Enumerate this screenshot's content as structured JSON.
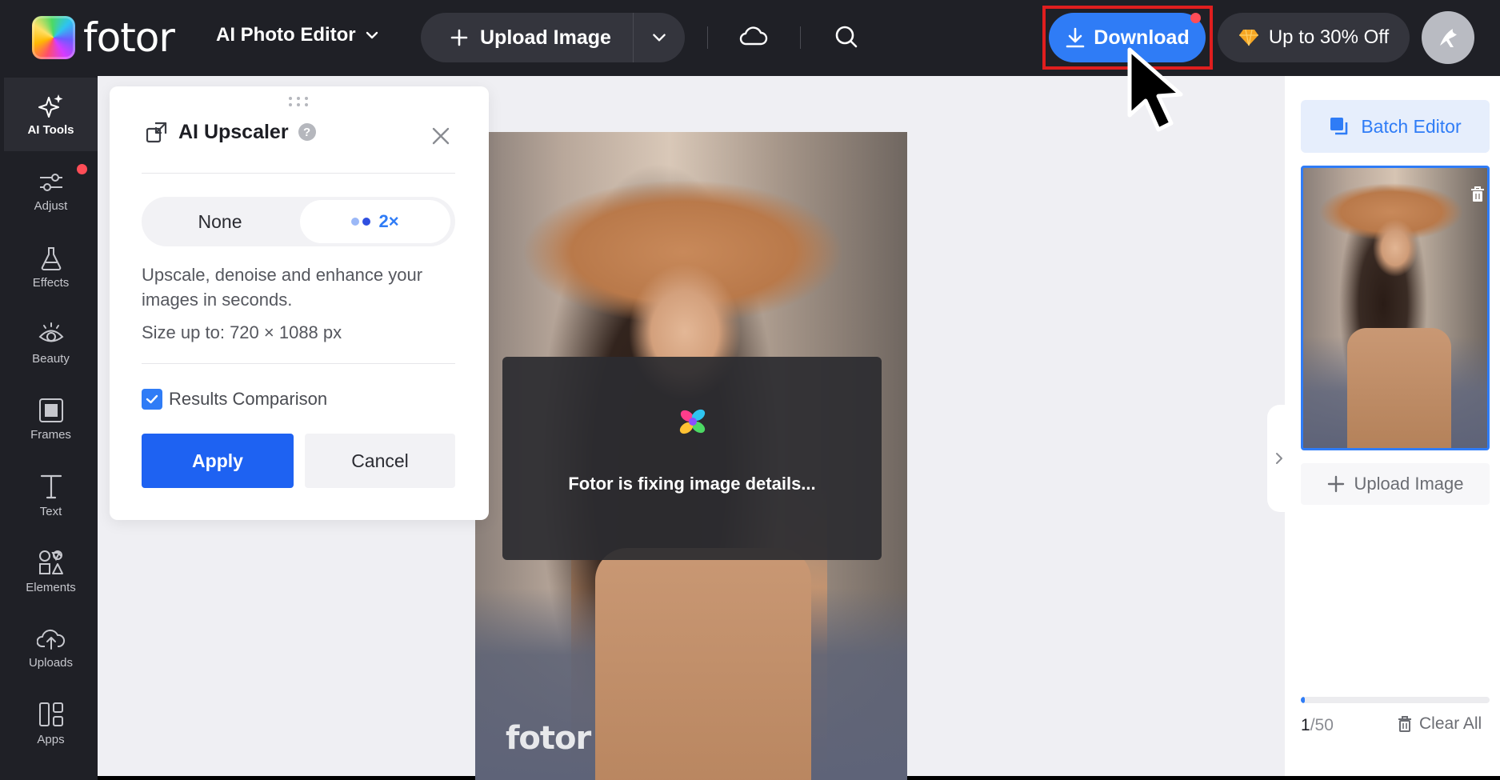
{
  "brand": {
    "logo_text": "fotor"
  },
  "toolbar": {
    "editor_label": "AI Photo Editor",
    "upload_label": "Upload Image",
    "download_label": "Download",
    "promo_label": "Up to 30% Off"
  },
  "rail": {
    "items": [
      {
        "label": "AI Tools",
        "icon": "sparkle-icon",
        "active": true
      },
      {
        "label": "Adjust",
        "icon": "sliders-icon"
      },
      {
        "label": "Effects",
        "icon": "flask-icon"
      },
      {
        "label": "Beauty",
        "icon": "eye-icon"
      },
      {
        "label": "Frames",
        "icon": "frame-icon"
      },
      {
        "label": "Text",
        "icon": "text-icon"
      },
      {
        "label": "Elements",
        "icon": "shapes-icon"
      },
      {
        "label": "Uploads",
        "icon": "cloud-upload-icon"
      },
      {
        "label": "Apps",
        "icon": "apps-icon"
      }
    ]
  },
  "upscaler": {
    "title": "AI Upscaler",
    "option_none": "None",
    "option_2x": "2×",
    "description": "Upscale, denoise and enhance your images in seconds.",
    "size_info": "Size up to: 720 × 1088 px",
    "comparison_label": "Results Comparison",
    "comparison_checked": true,
    "apply_label": "Apply",
    "cancel_label": "Cancel"
  },
  "canvas": {
    "watermark": "fotor",
    "progress_message": "Fotor is fixing image details..."
  },
  "sidebar_right": {
    "batch_label": "Batch Editor",
    "upload_label": "Upload Image",
    "count_current": "1",
    "count_total": "/50",
    "progress_fraction": 0.02,
    "clear_label": "Clear All"
  },
  "colors": {
    "accent": "#2f7cf6",
    "apply": "#1e62f2",
    "dark_bg": "#1f2026",
    "highlight_frame": "#e01e1e",
    "notify_dot": "#ff4d57"
  }
}
